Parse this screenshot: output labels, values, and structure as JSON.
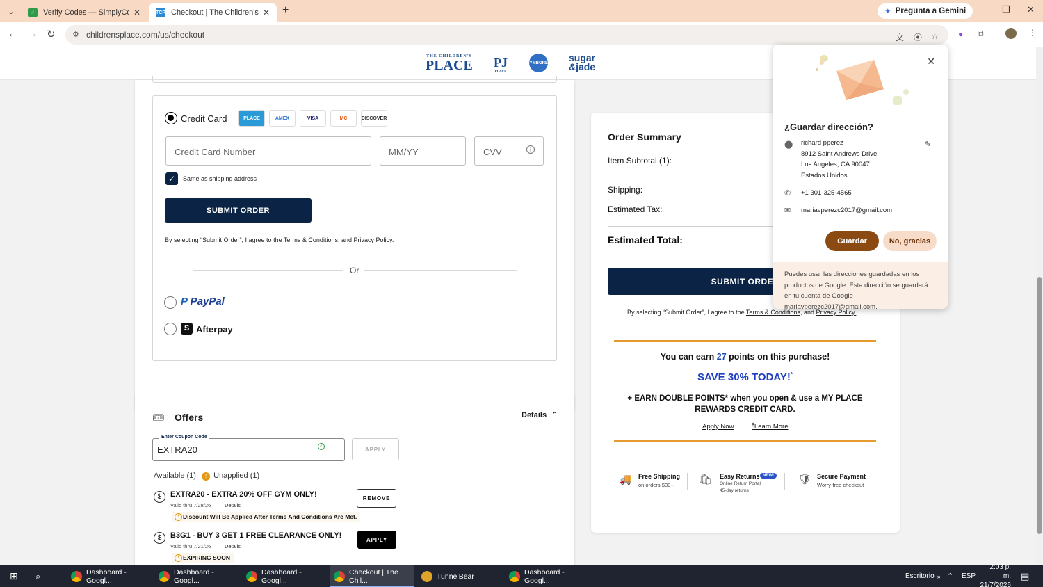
{
  "browser": {
    "tabs": [
      {
        "title": "Verify Codes — SimplyCodes",
        "active": false
      },
      {
        "title": "Checkout | The Children's Place",
        "active": true
      }
    ],
    "gemini_label": "Pregunta a Gemini",
    "url": "childrensplace.com/us/checkout"
  },
  "brands": {
    "place_small": "THE CHILDREN'S",
    "place": "PLACE",
    "pj": "PJ",
    "pj_small": "PLACE",
    "gym": "GYMBOREE",
    "sugar": "sugar",
    "jade": "&jade"
  },
  "payment": {
    "credit_card_label": "Credit Card",
    "card_logos": [
      "PLACE",
      "AMEX",
      "VISA",
      "MC",
      "DISCOVER"
    ],
    "card_number_placeholder": "Credit Card Number",
    "expiry_placeholder": "MM/YY",
    "cvv_placeholder": "CVV",
    "same_as_shipping": "Same as shipping address",
    "submit_label": "SUBMIT ORDER",
    "terms_prefix": "By selecting “Submit Order”, I agree to the",
    "terms_link": "Terms & Conditions",
    "terms_and": ", and",
    "privacy_link": "Privacy Policy.",
    "or_label": "Or",
    "paypal_label": "PayPal",
    "afterpay_label": "Afterpay"
  },
  "offers": {
    "title": "Offers",
    "details_label": "Details",
    "coupon_label": "Enter Coupon Code",
    "coupon_value": "EXTRA20",
    "apply_label": "APPLY",
    "available": "Available (1),",
    "unapplied": "Unapplied (1)",
    "items": [
      {
        "title": "EXTRA20 - EXTRA 20% OFF GYM ONLY!",
        "valid": "Valid thru 7/28/26",
        "details": "Details",
        "notice": "Discount Will Be Applied After Terms And Conditions Are Met.",
        "action": "REMOVE"
      },
      {
        "title": "B3G1 - BUY 3 GET 1 FREE CLEARANCE ONLY!",
        "valid": "Valid thru 7/21/26",
        "details": "Details",
        "notice": "EXPIRING SOON",
        "action": "APPLY"
      }
    ]
  },
  "summary": {
    "title": "Order Summary",
    "subtotal": "Item Subtotal (1):",
    "shipping": "Shipping:",
    "tax": "Estimated Tax:",
    "total": "Estimated Total:",
    "submit_label": "SUBMIT ORDER",
    "terms_prefix": "By selecting “Submit Order”, I agree to the",
    "terms_link": "Terms & Conditions",
    "terms_and": ", and",
    "privacy_link": "Privacy Policy.",
    "earn_prefix": "You can earn",
    "earn_points": "27",
    "earn_suffix": "points on this purchase!",
    "save_text": "SAVE 30% TODAY!",
    "save_mark": "*",
    "double_line1": "+ EARN DOUBLE POINTS* when you open & use a MY PLACE",
    "double_line2": "REWARDS CREDIT CARD.",
    "apply_now": "Apply Now",
    "learn_more": "Learn More",
    "features": [
      {
        "title": "Free Shipping",
        "sub": "on orders $30+"
      },
      {
        "title": "Easy Returns",
        "badge": "NEW!",
        "sub": "Online Return Portal",
        "sub2": "45-day returns"
      },
      {
        "title": "Secure Payment",
        "sub": "Worry-free checkout"
      }
    ]
  },
  "popup": {
    "title": "¿Guardar dirección?",
    "name": "richard pperez",
    "line1": "8912 Saint Andrews Drive",
    "line2": "Los Angeles, CA 90047",
    "country": "Estados Unidos",
    "phone": "+1 301-325-4565",
    "email": "mariavperezc2017@gmail.com",
    "save": "Guardar",
    "no": "No, gracias",
    "footer": "Puedes usar las direcciones guardadas en los productos de Google. Esta dirección se guardará en tu cuenta de Google mariavperezc2017@gmail.com."
  },
  "taskbar": {
    "items": [
      "Dashboard - Googl...",
      "Dashboard - Googl...",
      "Dashboard - Googl...",
      "Checkout | The Chil...",
      "TunnelBear",
      "Dashboard - Googl..."
    ],
    "desktop": "Escritorio",
    "lang": "ESP",
    "time": "2:03 p. m.",
    "date": "21/7/2026"
  }
}
